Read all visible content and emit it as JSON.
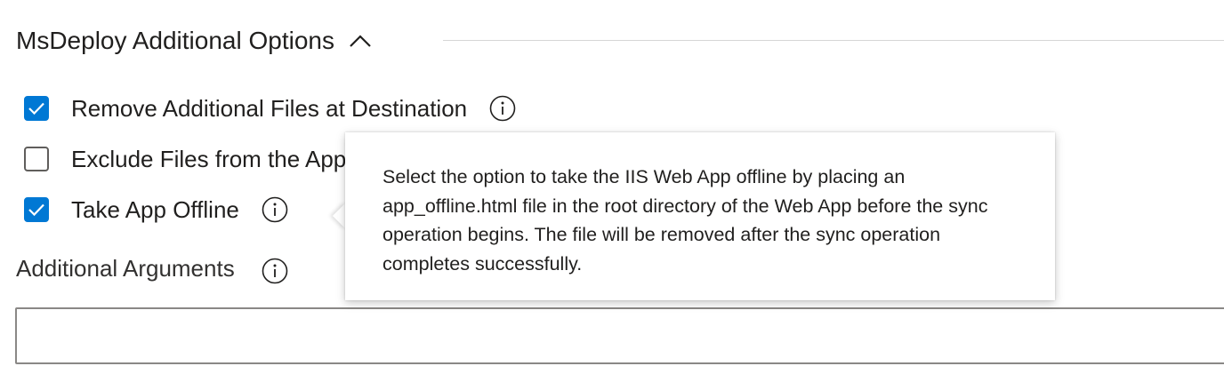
{
  "section": {
    "title": "MsDeploy Additional Options",
    "expanded": true,
    "chevron_icon": "chevron-up-icon"
  },
  "options": [
    {
      "label": "Remove Additional Files at Destination",
      "checked": true,
      "info_icon": "info-icon"
    },
    {
      "label": "Exclude Files from the App_Data Folder",
      "checked": false,
      "info_icon": "info-icon"
    },
    {
      "label": "Take App Offline",
      "checked": true,
      "info_icon": "info-icon"
    }
  ],
  "additional_arguments": {
    "label": "Additional Arguments",
    "value": "",
    "info_icon": "info-icon"
  },
  "tooltip": {
    "text": "Select the option to take the IIS Web App offline by placing an app_offline.html file in the root directory of the Web App before the sync operation begins. The file will be removed after the sync operation completes successfully."
  },
  "colors": {
    "accent": "#0078d4",
    "text": "#201f1e",
    "border": "#8a8886",
    "divider": "#d6d6d6"
  }
}
